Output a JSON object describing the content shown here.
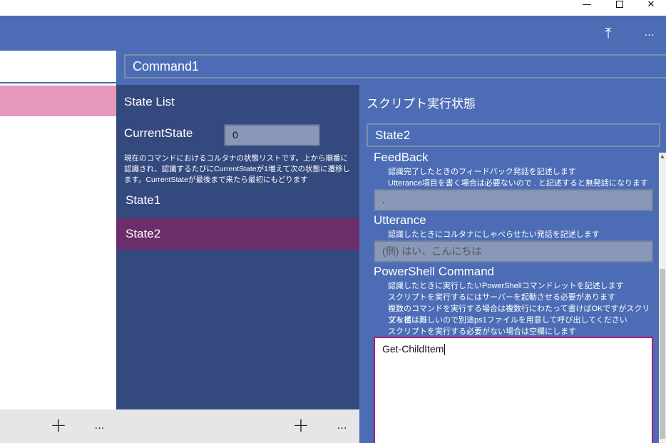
{
  "window": {
    "min_glyph": "—",
    "close_glyph": "✕"
  },
  "toolbar": {
    "upload_icon": "upload-icon",
    "upload_glyph": "⤒",
    "more_glyph": "…"
  },
  "command": {
    "name": "Command1"
  },
  "state_list": {
    "title": "State List",
    "current_state_label": "CurrentState",
    "current_state_value": "0",
    "description": "現在のコマンドにおけるコルタナの状態リストです。上から順番に認識され、認識するたびにCurrentStateが1増えて次の状態に遷移します。CurrentStateが最後まで来たら最初にもどります",
    "items": [
      {
        "label": "State1"
      },
      {
        "label": "State2",
        "selected": true
      }
    ]
  },
  "script": {
    "title": "スクリプト実行状態",
    "state_name": "State2",
    "feedback": {
      "title": "FeedBack",
      "desc1": "認識完了したときのフィードバック発話を記述します",
      "desc2": "Utterance項目を書く場合は必要ないので . と記述すると無発話になります",
      "value": "."
    },
    "utterance": {
      "title": "Utterance",
      "desc1": "認識したときにコルタナにしゃべらせたい発話を記述します",
      "placeholder": "(例) はい、こんにちは"
    },
    "powershell": {
      "title": "PowerShell Command",
      "desc1": "認識したときに実行したいPowerShellコマンドレットを記述します",
      "desc2": "スクリプトを実行するにはサーバーを起動させる必要があります",
      "desc3": "複数のコマンドを実行する場合は複数行にわたって書けばOKですがスクリプト構",
      "desc4": "文などは難しいので別途ps1ファイルを用意して呼び出してください",
      "desc5": "スクリプトを実行する必要がない場合は空欄にします",
      "value": "Get-ChildItem"
    }
  },
  "bottom_bar": {
    "plus_glyph": "+",
    "more_glyph": "…"
  },
  "colors": {
    "accent": "#4c6db5",
    "state_pane": "#34497e",
    "selected_state": "#6a2e6b",
    "left_selected": "#e598bb",
    "focus_border": "#b0197b"
  }
}
